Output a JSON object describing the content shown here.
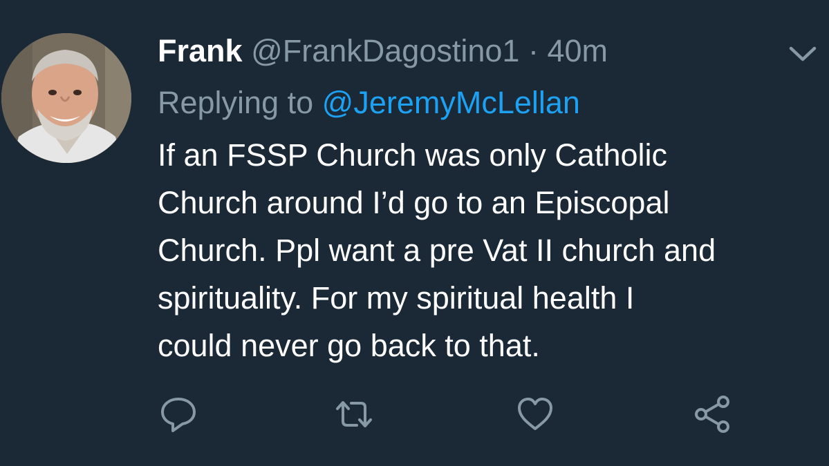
{
  "tweet": {
    "display_name": "Frank",
    "handle": "@FrankDagostino1",
    "separator": "·",
    "timestamp": "40m",
    "reply_prefix": "Replying to",
    "reply_to": "@JeremyMcLellan",
    "text": "If an FSSP Church was only Catholic\nChurch around I’d go to an Episcopal\nChurch. Ppl want a pre Vat II church and\nspirituality.  For my spiritual health I\ncould never go back to that."
  },
  "icons": {
    "menu": "chevron-down-icon",
    "reply": "reply-icon",
    "retweet": "retweet-icon",
    "like": "heart-icon",
    "share": "share-icon"
  },
  "colors": {
    "background": "#1b2836",
    "primary_text": "#ffffff",
    "secondary_text": "#8899a6",
    "link": "#1da1f2"
  }
}
